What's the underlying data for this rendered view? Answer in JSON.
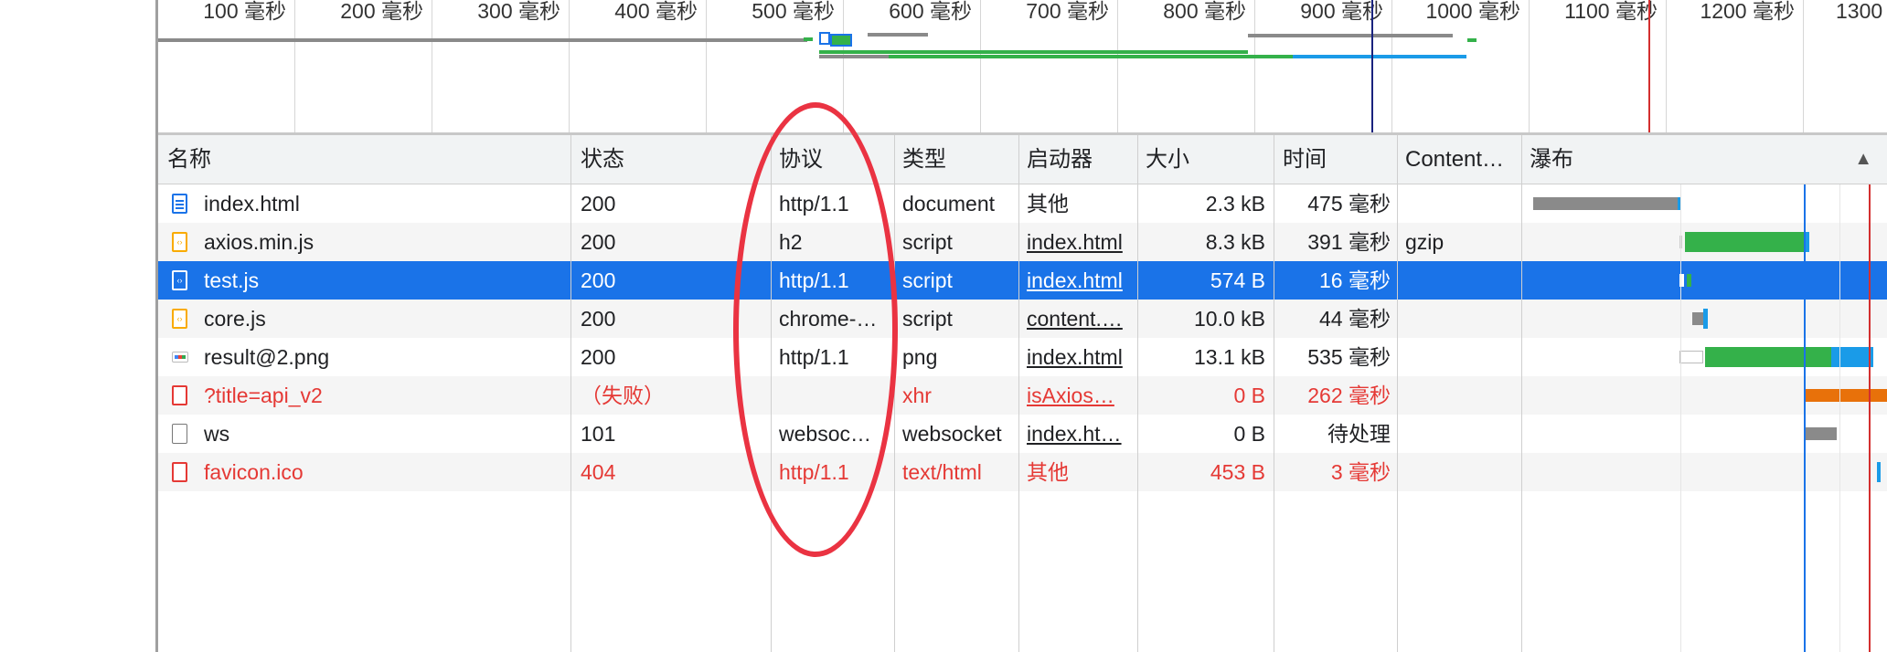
{
  "overview": {
    "tick_labels": [
      "100 毫秒",
      "200 毫秒",
      "300 毫秒",
      "400 毫秒",
      "500 毫秒",
      "600 毫秒",
      "700 毫秒",
      "800 毫秒",
      "900 毫秒",
      "1000 毫秒",
      "1100 毫秒",
      "1200 毫秒",
      "1300"
    ]
  },
  "table": {
    "columns": [
      "名称",
      "状态",
      "协议",
      "类型",
      "启动器",
      "大小",
      "时间",
      "Content…",
      "瀑布"
    ],
    "sort_indicator": "▲",
    "rows": [
      {
        "name": "index.html",
        "status": "200",
        "protocol": "http/1.1",
        "type": "document",
        "initiator": "其他",
        "size": "2.3 kB",
        "time": "475 毫秒",
        "content": "",
        "icon": "document-icon"
      },
      {
        "name": "axios.min.js",
        "status": "200",
        "protocol": "h2",
        "type": "script",
        "initiator": "index.html",
        "size": "8.3 kB",
        "time": "391 毫秒",
        "content": "gzip",
        "icon": "script-icon"
      },
      {
        "name": "test.js",
        "status": "200",
        "protocol": "http/1.1",
        "type": "script",
        "initiator": "index.html",
        "size": "574 B",
        "time": "16 毫秒",
        "content": "",
        "icon": "script-icon"
      },
      {
        "name": "core.js",
        "status": "200",
        "protocol": "chrome-…",
        "type": "script",
        "initiator": "content.…",
        "size": "10.0 kB",
        "time": "44 毫秒",
        "content": "",
        "icon": "script-icon"
      },
      {
        "name": "result@2.png",
        "status": "200",
        "protocol": "http/1.1",
        "type": "png",
        "initiator": "index.html",
        "size": "13.1 kB",
        "time": "535 毫秒",
        "content": "",
        "icon": "image-icon"
      },
      {
        "name": "?title=api_v2",
        "status": "（失败）",
        "protocol": "",
        "type": "xhr",
        "initiator": "isAxios…",
        "size": "0 B",
        "time": "262 毫秒",
        "content": "",
        "icon": "error-icon"
      },
      {
        "name": "ws",
        "status": "101",
        "protocol": "websoc…",
        "type": "websocket",
        "initiator": "index.ht…",
        "size": "0 B",
        "time": "待处理",
        "content": "",
        "icon": "blank-icon"
      },
      {
        "name": "favicon.ico",
        "status": "404",
        "protocol": "http/1.1",
        "type": "text/html",
        "initiator": "其他",
        "size": "453 B",
        "time": "3 毫秒",
        "content": "",
        "icon": "error-icon"
      }
    ]
  },
  "colors": {
    "selected_row": "#1a73e8",
    "error_text": "#e53935",
    "annotation": "#ea3342",
    "waterfall_waiting": "#34b14a",
    "waterfall_download": "#1a9be8",
    "waterfall_queue": "#8a8a8a",
    "waterfall_xhr": "#e8710a"
  }
}
